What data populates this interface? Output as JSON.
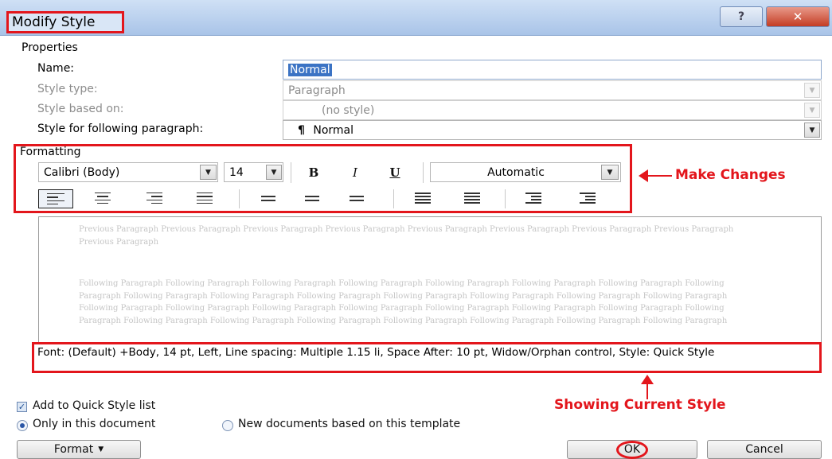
{
  "window": {
    "title": "Modify Style",
    "help_label": "?",
    "close_label": "✕"
  },
  "properties": {
    "section_label": "Properties",
    "name_label": "Name:",
    "name_value": "Normal",
    "style_type_label": "Style type:",
    "style_type_value": "Paragraph",
    "based_on_label": "Style based on:",
    "based_on_value": "(no style)",
    "following_label": "Style for following paragraph:",
    "following_value": "Normal",
    "following_icon": "¶"
  },
  "formatting": {
    "section_label": "Formatting",
    "font_value": "Calibri (Body)",
    "size_value": "14",
    "bold_label": "B",
    "italic_label": "I",
    "underline_label": "U",
    "color_value": "Automatic"
  },
  "preview": {
    "previous_paragraph": "Previous Paragraph Previous Paragraph Previous Paragraph Previous Paragraph Previous Paragraph Previous Paragraph Previous Paragraph Previous Paragraph Previous Paragraph",
    "following_paragraph": "Following Paragraph Following Paragraph Following Paragraph Following Paragraph Following Paragraph Following Paragraph Following Paragraph Following Paragraph Following Paragraph Following Paragraph Following Paragraph Following Paragraph Following Paragraph Following Paragraph Following Paragraph Following Paragraph Following Paragraph Following Paragraph Following Paragraph Following Paragraph Following Paragraph Following Paragraph Following Paragraph Following Paragraph Following Paragraph Following Paragraph Following Paragraph Following Paragraph Following Paragraph Following Paragraph"
  },
  "description": "Font: (Default) +Body, 14 pt, Left, Line spacing:  Multiple 1.15 li, Space After:  10 pt, Widow/Orphan control, Style: Quick Style",
  "annotations": {
    "make_changes": "Make Changes",
    "showing_current_style": "Showing Current Style",
    "color": "#e3161c"
  },
  "options": {
    "add_quick_style_label": "Add to Quick Style list",
    "add_quick_style_checked": true,
    "only_this_document_label": "Only in this document",
    "new_documents_label": "New documents based on this template",
    "selected_scope": "Only in this document"
  },
  "buttons": {
    "format_label": "Format",
    "ok_label": "OK",
    "cancel_label": "Cancel"
  }
}
